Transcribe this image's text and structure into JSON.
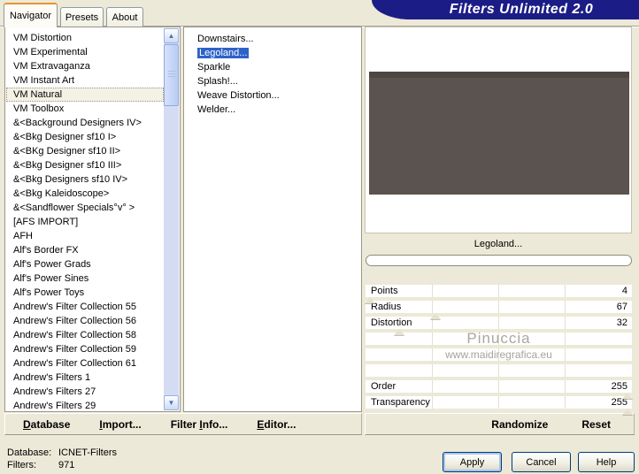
{
  "banner": {
    "title": "Filters Unlimited 2.0",
    "bg": "#1c1c86"
  },
  "tabs": {
    "items": [
      {
        "label": "Navigator",
        "active": true
      },
      {
        "label": "Presets",
        "active": false
      },
      {
        "label": "About",
        "active": false
      }
    ]
  },
  "category_panel": {
    "selected_index": 4,
    "items": [
      "VM Distortion",
      "VM Experimental",
      "VM Extravaganza",
      "VM Instant Art",
      "VM Natural",
      "VM Toolbox",
      "&<Background Designers IV>",
      "&<Bkg Designer sf10 I>",
      "&<BKg Designer sf10 II>",
      "&<Bkg Designer sf10 III>",
      "&<Bkg Designers sf10 IV>",
      "&<Bkg Kaleidoscope>",
      "&<Sandflower Specials°v° >",
      "[AFS IMPORT]",
      "AFH",
      "Alf's Border FX",
      "Alf's Power Grads",
      "Alf's Power Sines",
      "Alf's Power Toys",
      "Andrew's Filter Collection 55",
      "Andrew's Filter Collection 56",
      "Andrew's Filter Collection 58",
      "Andrew's Filter Collection 59",
      "Andrew's Filter Collection 61",
      "Andrew's Filters 1",
      "Andrew's Filters 27",
      "Andrew's Filters 29"
    ]
  },
  "filter_panel": {
    "selected_index": 1,
    "items": [
      "Downstairs...",
      "Legoland...",
      "Sparkle",
      "Splash!...",
      "Weave Distortion...",
      "Welder..."
    ]
  },
  "preview": {
    "label": "Legoland...",
    "progress_percent": 0,
    "image_color": "#5b534f"
  },
  "sliders": {
    "max": 255,
    "items": [
      {
        "label": "Points",
        "value": 4
      },
      {
        "label": "Radius",
        "value": 67
      },
      {
        "label": "Distortion",
        "value": 32
      },
      {
        "label": "Order",
        "value": 255
      },
      {
        "label": "Transparency",
        "value": 255
      }
    ]
  },
  "watermark": {
    "line1": "Pinuccia",
    "line2": "www.maidiregrafica.eu"
  },
  "toolbar": {
    "left_items": [
      {
        "label": "Database",
        "underline": 0
      },
      {
        "label": "Import...",
        "underline": 0
      },
      {
        "label": "Filter Info...",
        "underline": 7
      },
      {
        "label": "Editor...",
        "underline": 0
      }
    ],
    "right_items": [
      {
        "label": "Randomize",
        "underline": -1
      },
      {
        "label": "Reset",
        "underline": -1
      }
    ]
  },
  "status": {
    "rows": [
      {
        "label": "Database:",
        "value": "ICNET-Filters"
      },
      {
        "label": "Filters:",
        "value": "971"
      }
    ]
  },
  "buttons": [
    {
      "label": "Apply",
      "focused": true
    },
    {
      "label": "Cancel",
      "focused": false
    },
    {
      "label": "Help",
      "focused": false
    }
  ],
  "colors": {
    "dialog_bg": "#ECE9D8",
    "banner_navy": "#1c1c86",
    "selection_blue": "#2E62C8",
    "tab_accent_orange": "#E8942F",
    "preview_dark": "#5b534f",
    "watermark_gray": "#ABA89E"
  }
}
